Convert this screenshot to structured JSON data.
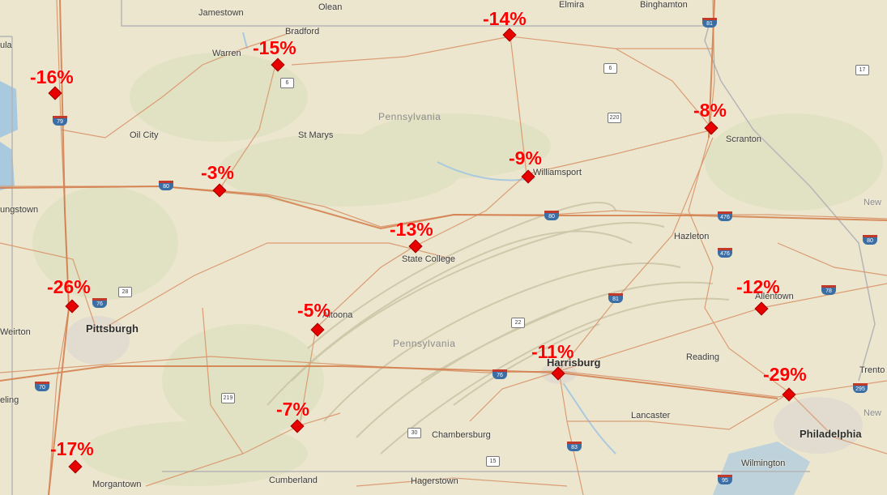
{
  "map": {
    "states": [
      "Pennsylvania",
      "Pennsylvania"
    ],
    "cities": [
      "Jamestown",
      "Olean",
      "Bradford",
      "Elmira",
      "Binghamton",
      "Warren",
      "Oil City",
      "St Marys",
      "Williamsport",
      "Scranton",
      "ungstown",
      "State College",
      "Hazleton",
      "Allentown",
      "Pittsburgh",
      "Weirton",
      "Altoona",
      "Harrisburg",
      "Reading",
      "Trento",
      "New",
      "New",
      "Lancaster",
      "Philadelphia",
      "Chambersburg",
      "eling",
      "Morgantown",
      "Cumberland",
      "Hagerstown",
      "Wilmington",
      "ula"
    ],
    "shields": [
      "81",
      "79",
      "80",
      "80",
      "476",
      "476",
      "80",
      "76",
      "81",
      "78",
      "22",
      "76",
      "70",
      "219",
      "30",
      "15",
      "83",
      "95",
      "28",
      "6",
      "6",
      "220",
      "17",
      "295"
    ],
    "measurements": [
      {
        "label": "-16%",
        "value": -16
      },
      {
        "label": "-15%",
        "value": -15
      },
      {
        "label": "-14%",
        "value": -14
      },
      {
        "label": "-8%",
        "value": -8
      },
      {
        "label": "-9%",
        "value": -9
      },
      {
        "label": "-3%",
        "value": -3
      },
      {
        "label": "-13%",
        "value": -13
      },
      {
        "label": "-26%",
        "value": -26
      },
      {
        "label": "-5%",
        "value": -5
      },
      {
        "label": "-12%",
        "value": -12
      },
      {
        "label": "-11%",
        "value": -11
      },
      {
        "label": "-29%",
        "value": -29
      },
      {
        "label": "-7%",
        "value": -7
      },
      {
        "label": "-17%",
        "value": -17
      }
    ],
    "colors": {
      "land": "#ece6cf",
      "road": "#d98c5f",
      "interstate_road": "#d47b49",
      "border": "#b5b5b5",
      "water": "#a9c9df",
      "marker": "#e60000",
      "label": "#ff0000"
    }
  }
}
